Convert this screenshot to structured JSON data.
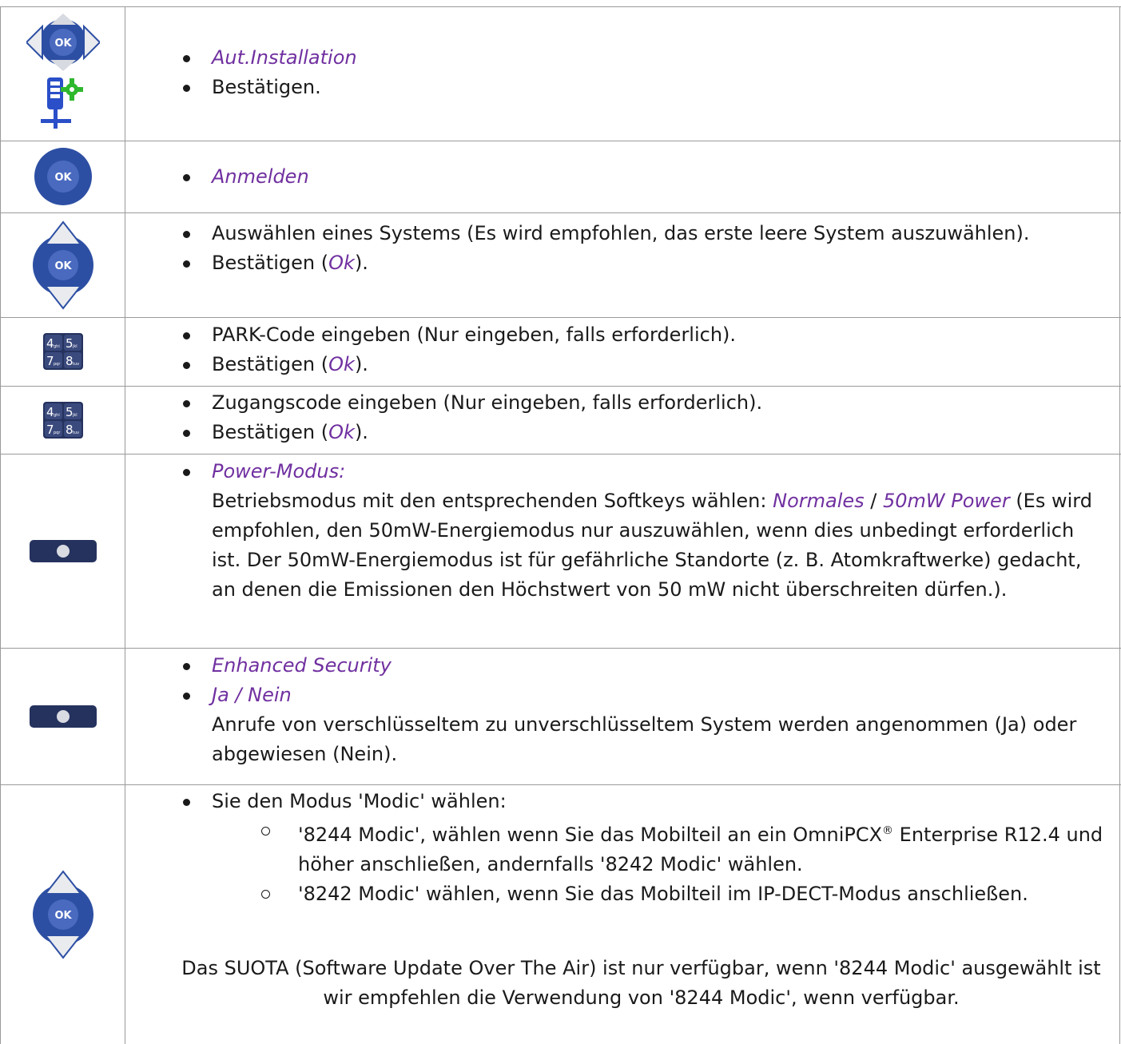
{
  "colors": {
    "highlight": "#7030a0",
    "border": "#9a9a9a",
    "key_blue": "#3a5bb0",
    "key_dark": "#25325e"
  },
  "icons": [
    "navigation-ok-4way-icon",
    "install-handset-icon",
    "ok-button-icon",
    "navigation-ok-updown-icon",
    "keypad-icon",
    "softkey-icon"
  ],
  "keypad": {
    "k4": "4",
    "k4s": "ghi",
    "k5": "5",
    "k5s": "jkl",
    "k7": "7",
    "k7s": "pqr",
    "k8": "8",
    "k8s": "tuv"
  },
  "ok_label": "OK",
  "rows": {
    "r1": {
      "item1": "Aut.Installation",
      "item2": "Bestätigen."
    },
    "r2": {
      "item1": "Anmelden"
    },
    "r3": {
      "item1": "Auswählen eines Systems (Es wird empfohlen, das erste leere System auszuwählen).",
      "item2_a": "Bestätigen (",
      "item2_hl": "Ok",
      "item2_b": ")."
    },
    "r4": {
      "item1": "PARK-Code eingeben (Nur eingeben, falls erforderlich).",
      "item2_a": "Bestätigen (",
      "item2_hl": "Ok",
      "item2_b": ")."
    },
    "r5": {
      "item1": "Zugangscode eingeben (Nur eingeben, falls erforderlich).",
      "item2_a": "Bestätigen (",
      "item2_hl": "Ok",
      "item2_b": ")."
    },
    "r6": {
      "item1": "Power-Modus:",
      "para_a": "Betriebsmodus mit den entsprechenden Softkeys wählen: ",
      "para_hl1": "Normales",
      "para_sep": " / ",
      "para_hl2": "50mW Power",
      "para_b": " (Es wird empfohlen, den 50mW-Energiemodus nur auszuwählen, wenn dies unbedingt erforderlich ist. Der 50mW-Energiemodus ist für gefährliche Standorte (z. B. Atomkraftwerke) gedacht, an denen die Emissionen den Höchstwert von 50 mW nicht überschreiten dürfen.)."
    },
    "r7": {
      "item1": "Enhanced Security",
      "item2": "Ja / Nein",
      "para": "Anrufe von verschlüsseltem zu unverschlüsseltem System werden angenommen (Ja) oder abgewiesen (Nein)."
    },
    "r8": {
      "item1": "Sie den Modus 'Modic' wählen:",
      "sub1_a": "'8244 Modic', wählen wenn Sie das Mobilteil an ein OmniPCX",
      "sub1_reg": "®",
      "sub1_b": " Enterprise R12.4 und höher anschließen, andernfalls '8242 Modic' wählen.",
      "sub2": "'8242 Modic' wählen, wenn Sie das Mobilteil im IP-DECT-Modus anschließen.",
      "note": "Das SUOTA (Software Update Over The Air) ist nur verfügbar, wenn '8244 Modic' ausgewählt ist wir empfehlen die Verwendung von '8244 Modic', wenn verfügbar."
    }
  }
}
